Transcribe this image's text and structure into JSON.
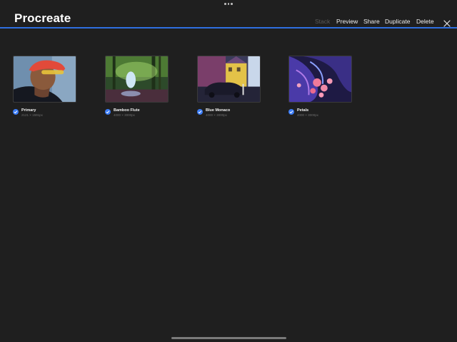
{
  "app": {
    "title": "Procreate"
  },
  "toolbar": {
    "stack_label": "Stack",
    "preview_label": "Preview",
    "share_label": "Share",
    "duplicate_label": "Duplicate",
    "delete_label": "Delete",
    "close_icon": "close-icon"
  },
  "gallery": {
    "items": [
      {
        "name": "Primary",
        "dimensions": "2121 × 1591px",
        "selected": true
      },
      {
        "name": "Bamboo Flute",
        "dimensions": "4000 × 3000px",
        "selected": true
      },
      {
        "name": "Blue Monaco",
        "dimensions": "4000 × 3000px",
        "selected": true
      },
      {
        "name": "Petals",
        "dimensions": "4000 × 3000px",
        "selected": true
      }
    ]
  },
  "colors": {
    "accent": "#2f6fe0",
    "checkmark": "#3b7cf5",
    "background": "#1f1f1f"
  }
}
